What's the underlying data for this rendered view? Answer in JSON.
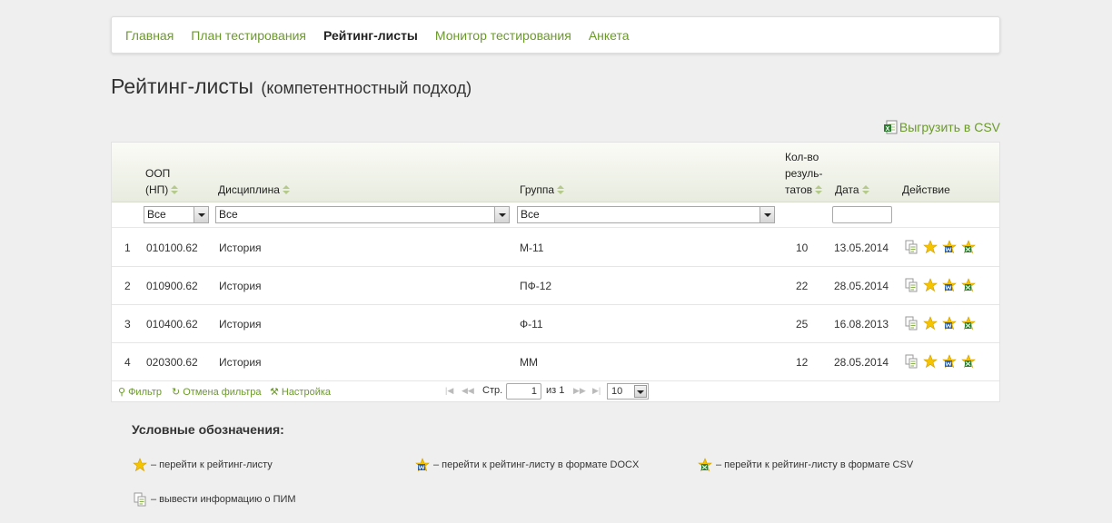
{
  "nav": {
    "items": [
      {
        "label": "Главная",
        "active": false
      },
      {
        "label": "План тестирования",
        "active": false
      },
      {
        "label": "Рейтинг-листы",
        "active": true
      },
      {
        "label": "Монитор тестирования",
        "active": false
      },
      {
        "label": "Анкета",
        "active": false
      }
    ]
  },
  "page": {
    "title": "Рейтинг-листы",
    "subtitle": "(компетентностный подход)",
    "export_label": "Выгрузить в CSV"
  },
  "table": {
    "headers": {
      "oop_line1": "ООП",
      "oop_line2": "(НП)",
      "discipline": "Дисциплина",
      "group": "Группа",
      "count_line1": "Кол-во",
      "count_line2": "резуль-",
      "count_line3": "татов",
      "date": "Дата",
      "action": "Действие"
    },
    "filters": {
      "oop": "Все",
      "discipline": "Все",
      "group": "Все",
      "date": ""
    },
    "rows": [
      {
        "num": "1",
        "oop": "010100.62",
        "discipline": "История",
        "group": "М-11",
        "count": "10",
        "date": "13.05.2014"
      },
      {
        "num": "2",
        "oop": "010900.62",
        "discipline": "История",
        "group": "ПФ-12",
        "count": "22",
        "date": "28.05.2014"
      },
      {
        "num": "3",
        "oop": "010400.62",
        "discipline": "История",
        "group": "Ф-11",
        "count": "25",
        "date": "16.08.2013"
      },
      {
        "num": "4",
        "oop": "020300.62",
        "discipline": "История",
        "group": "ММ",
        "count": "12",
        "date": "28.05.2014"
      }
    ]
  },
  "pager": {
    "filter_label": "Фильтр",
    "cancel_filter_label": "Отмена фильтра",
    "settings_label": "Настройка",
    "page_label": "Стр.",
    "page_value": "1",
    "of_label": "из 1",
    "per_page": "10"
  },
  "legend": {
    "title": "Условные обозначения:",
    "star": "– перейти к рейтинг-листу",
    "docx": "– перейти к рейтинг-листу в формате DOCX",
    "csv": "– перейти к рейтинг-листу в формате CSV",
    "pim": "– вывести информацию о ПИМ"
  },
  "colors": {
    "link": "#6b9a2a",
    "star": "#f5c400",
    "header_gradient_end": "#e8ecdf"
  }
}
